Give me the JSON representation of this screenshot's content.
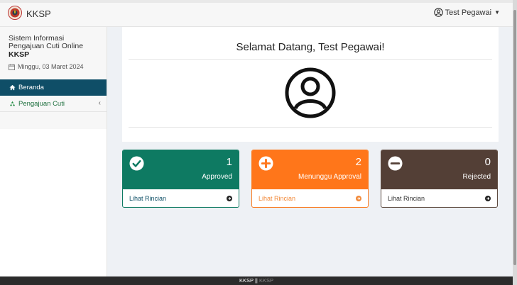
{
  "header": {
    "brand": "KKSP",
    "user_name": "Test Pegawai"
  },
  "sidebar": {
    "app_title": "Sistem Informasi Pengajuan Cuti Online",
    "org": "KKSP",
    "date": "Minggu, 03 Maret 2024",
    "items": [
      {
        "label": "Beranda",
        "icon": "home-icon",
        "active": true
      },
      {
        "label": "Pengajuan Cuti",
        "icon": "recycle-icon",
        "active": false
      }
    ]
  },
  "main": {
    "welcome": "Selamat Datang, Test Pegawai!",
    "cards": [
      {
        "count": "1",
        "label": "Approved",
        "link": "Lihat Rincian",
        "icon": "check-circle-icon",
        "color": "#0e7a62"
      },
      {
        "count": "2",
        "label": "Menunggu Approval",
        "link": "Lihat Rincian",
        "icon": "plus-circle-icon",
        "color": "#ff761a"
      },
      {
        "count": "0",
        "label": "Rejected",
        "link": "Lihat Rincian",
        "icon": "minus-circle-icon",
        "color": "#533f36"
      }
    ]
  },
  "footer": {
    "left": "KKSP ||",
    "right": "KKSP"
  }
}
